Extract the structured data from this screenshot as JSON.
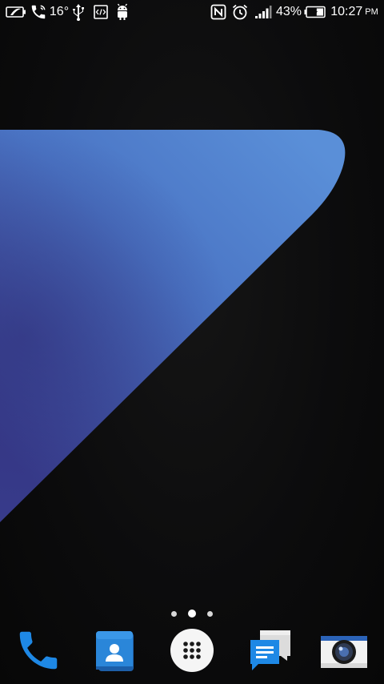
{
  "status_bar": {
    "temperature": "16°",
    "battery_percent": "43%",
    "battery_level": 0.43,
    "time": "10:27",
    "ampm": "PM",
    "left_icons": [
      "battery-saver-icon",
      "phone-call-icon",
      "usb-icon",
      "developer-options-icon",
      "android-debug-icon"
    ],
    "right_icons": [
      "nfc-icon",
      "alarm-icon",
      "signal-icon",
      "battery-icon"
    ]
  },
  "home": {
    "pages": 3,
    "current_page": 2
  },
  "dock": {
    "apps": [
      {
        "id": "phone",
        "icon": "phone-icon"
      },
      {
        "id": "contacts",
        "icon": "contacts-icon"
      },
      {
        "id": "app-drawer",
        "icon": "app-drawer-icon"
      },
      {
        "id": "messages",
        "icon": "messages-icon"
      },
      {
        "id": "camera",
        "icon": "camera-icon"
      }
    ]
  },
  "colors": {
    "background": "#0b0b0c",
    "wallpaper_light": "#5b8fd6",
    "wallpaper_dark": "#3a3f8f",
    "phone_blue": "#1e88e5",
    "contacts_blue": "#2a7fd0",
    "messages_blue": "#1e88e5"
  }
}
